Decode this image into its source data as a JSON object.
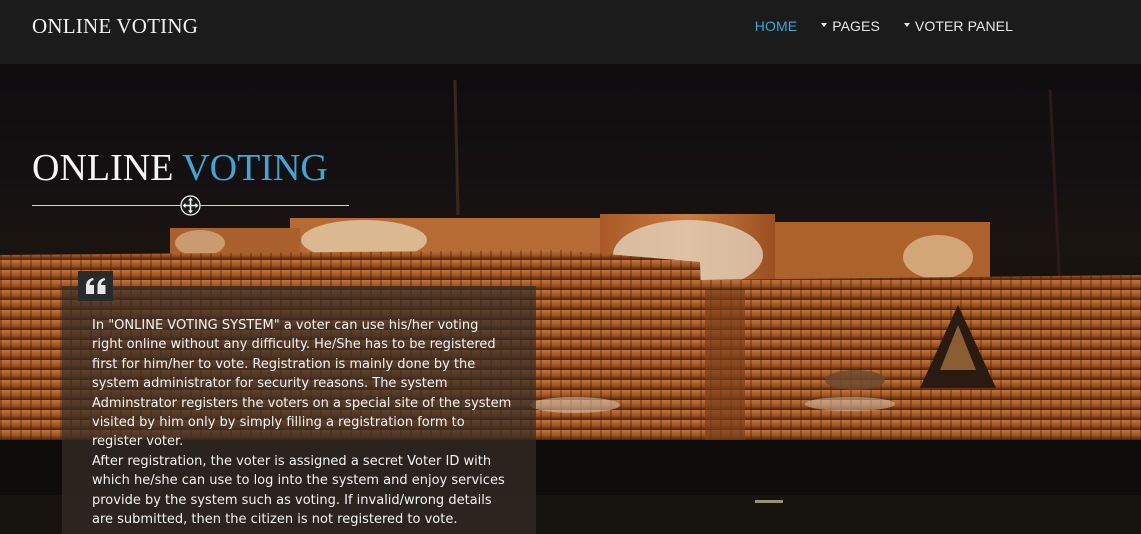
{
  "navbar": {
    "brand": "ONLINE VOTING",
    "items": [
      {
        "label": "HOME",
        "active": true,
        "dropdown": false
      },
      {
        "label": "PAGES",
        "active": false,
        "dropdown": true
      },
      {
        "label": "VOTER PANEL",
        "active": false,
        "dropdown": true
      }
    ]
  },
  "hero": {
    "title_part1": "ONLINE",
    "title_part2": "VOTING"
  },
  "quote": {
    "paragraph1": "In \"ONLINE VOTING SYSTEM\" a voter can use his/her voting right online without any difficulty. He/She has to be registered first for him/her to vote. Registration is mainly done by the system administrator for security reasons. The system Adminstrator registers the voters on a special site of the system visited by him only by simply filling a registration form to register voter.",
    "paragraph2": "After registration, the voter is assigned a secret Voter ID with which he/she can use to log into the system and enjoy services provide by the system such as voting. If invalid/wrong details are submitted, then the citizen is not registered to vote."
  },
  "colors": {
    "accent": "#3fa6d6",
    "navbar": "#1b1b1b",
    "building": "#b8692e"
  },
  "icons": {
    "quote": "quote-icon",
    "move": "move-cursor-icon",
    "dropdown": "caret-down-icon"
  }
}
